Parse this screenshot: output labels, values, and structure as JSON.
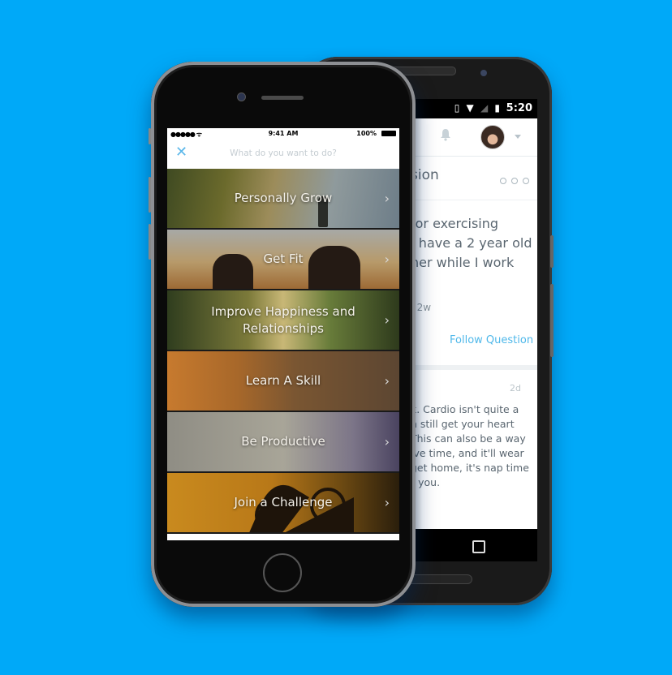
{
  "background_color": "#00a9f8",
  "android": {
    "status_bar": {
      "time": "5:20",
      "icons": [
        "vibrate-icon",
        "wifi-icon",
        "signal-icon",
        "battery-charging-icon"
      ]
    },
    "header": {
      "icons": [
        "bell-icon",
        "avatar",
        "caret-down-icon"
      ]
    },
    "title_fragment": "sion",
    "more_icon": "more-dots-icon",
    "question_lines": [
      "for exercising",
      "I have a 2 year old",
      "her while I work"
    ],
    "question_meta": "· 2w",
    "follow_label": "Follow Question",
    "answer_time": "2d",
    "answer_lines": [
      "k. Cardio isn't quite a",
      "n still get your heart",
      " This can also be a way",
      "ive time, and it'll wear",
      "get home, it's nap time",
      "r you."
    ],
    "nav_icon": "recent-apps-icon",
    "accent_color": "#4fb8ea"
  },
  "iphone": {
    "status_bar": {
      "signal": "●●●●● ᯤ",
      "time": "9:41 AM",
      "battery": "100%"
    },
    "header": {
      "close_icon": "close-icon",
      "placeholder": "What do you want to do?"
    },
    "menu": [
      {
        "label": "Personally Grow"
      },
      {
        "label": "Get Fit"
      },
      {
        "label": "Improve Happiness and Relationships"
      },
      {
        "label": "Learn A Skill"
      },
      {
        "label": "Be Productive"
      },
      {
        "label": "Join a Challenge"
      }
    ],
    "chevron": "›",
    "close_glyph": "✕"
  }
}
